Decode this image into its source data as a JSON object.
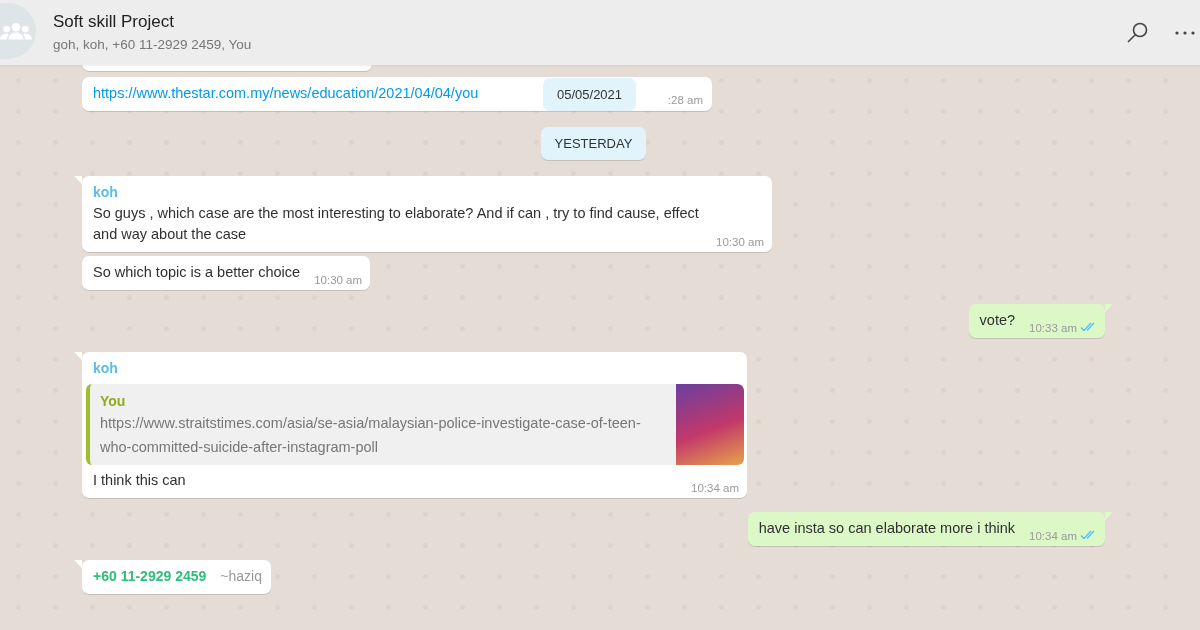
{
  "header": {
    "title": "Soft skill Project",
    "subtitle": "goh, koh, +60 11-2929 2459, You"
  },
  "floating_date": "05/05/2021",
  "messages": [
    {
      "kind": "partial"
    },
    {
      "kind": "in",
      "link": "https://www.thestar.com.my/news/education/2021/04/04/you",
      "time": ":28 am"
    },
    {
      "kind": "date",
      "text": "YESTERDAY"
    },
    {
      "kind": "in",
      "sender": "koh",
      "color": "#5bbde8",
      "text": "So guys , which case are the most interesting to elaborate? And if can , try to find cause, effect and way about the case",
      "time": "10:30 am"
    },
    {
      "kind": "in",
      "text": "So which topic is a better choice",
      "time": "10:30 am"
    },
    {
      "kind": "out",
      "text": "vote?",
      "time": "10:33 am",
      "read": true
    },
    {
      "kind": "in",
      "sender": "koh",
      "color": "#5bbde8",
      "quote": {
        "author": "You",
        "text": "https://www.straitstimes.com/asia/se-asia/malaysian-police-investigate-case-of-teen-who-committed-suicide-after-instagram-poll"
      },
      "text": "I think this can",
      "time": "10:34 am"
    },
    {
      "kind": "out",
      "text": "have insta so can elaborate more i think",
      "time": "10:34 am",
      "read": true
    },
    {
      "kind": "in",
      "sender": "+60 11-2929 2459",
      "color": "#2fbf7a",
      "alias": "~haziq"
    }
  ]
}
